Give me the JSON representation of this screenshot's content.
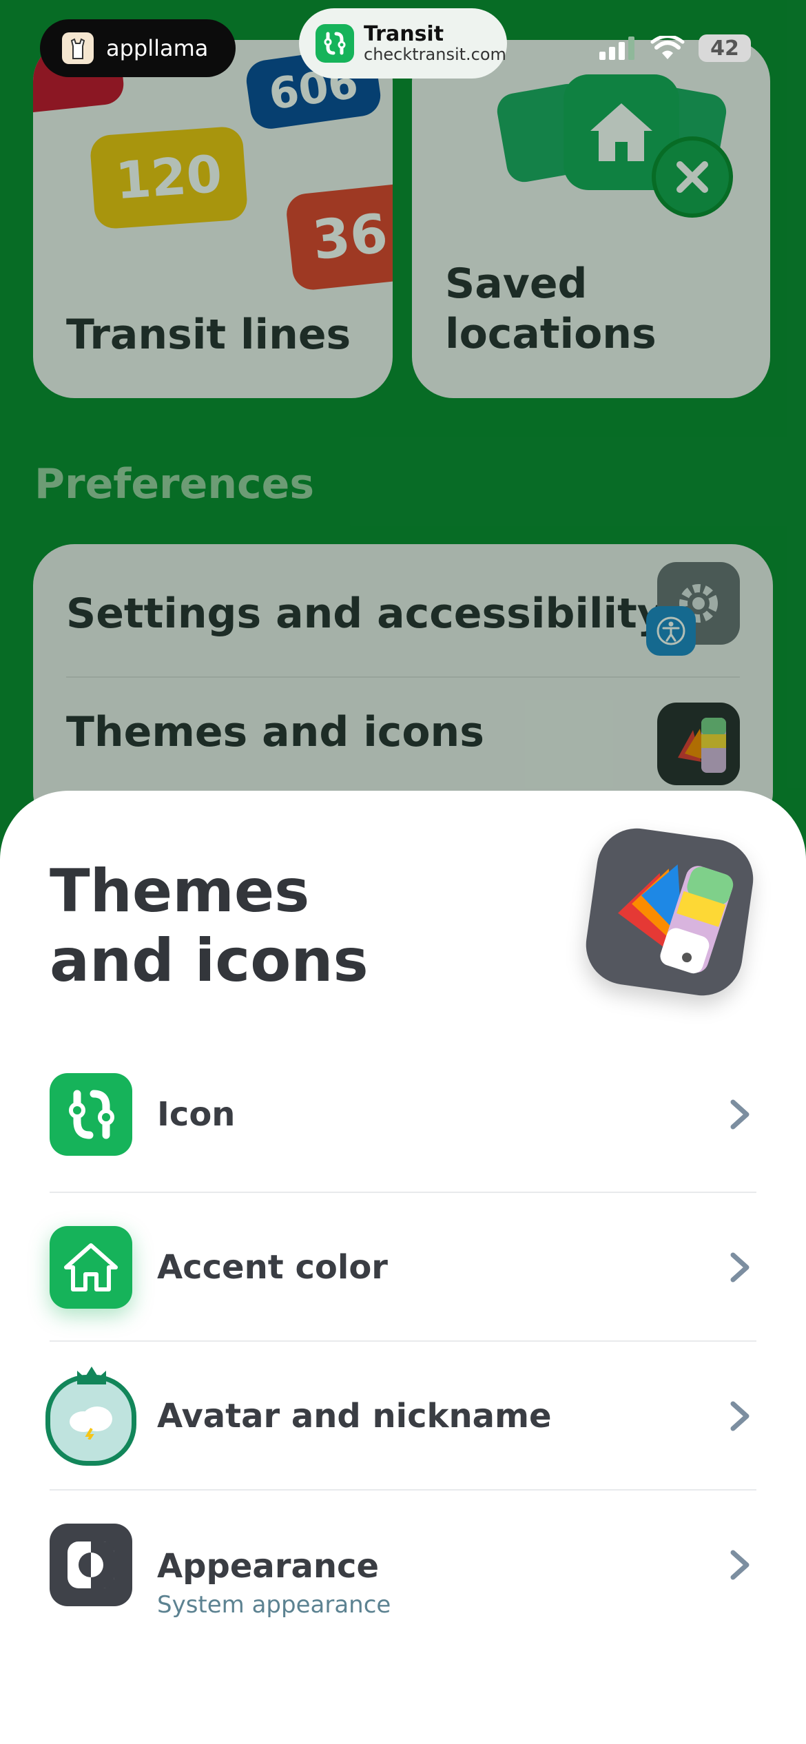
{
  "status_bar": {
    "app_pill_label": "appllama",
    "transit_pill": {
      "title": "Transit",
      "subtitle": "checktransit.com"
    },
    "battery": "42"
  },
  "background": {
    "cards": [
      {
        "title": "Transit lines",
        "chips": [
          "606",
          "120",
          "36"
        ]
      },
      {
        "title": "Saved locations"
      }
    ],
    "section_heading": "Preferences",
    "preferences": [
      {
        "label": "Settings and accessibility"
      },
      {
        "label": "Themes and icons"
      }
    ]
  },
  "sheet": {
    "title": "Themes and icons",
    "items": [
      {
        "label": "Icon",
        "icon": "transit-logo-icon"
      },
      {
        "label": "Accent color",
        "icon": "home-icon"
      },
      {
        "label": "Avatar and nickname",
        "icon": "avatar-icon"
      },
      {
        "label": "Appearance",
        "sublabel": "System appearance",
        "icon": "appearance-icon"
      }
    ]
  },
  "colors": {
    "accent": "#16b35a",
    "background_green": "#0b8a32",
    "chevron": "#7c8ea0"
  }
}
